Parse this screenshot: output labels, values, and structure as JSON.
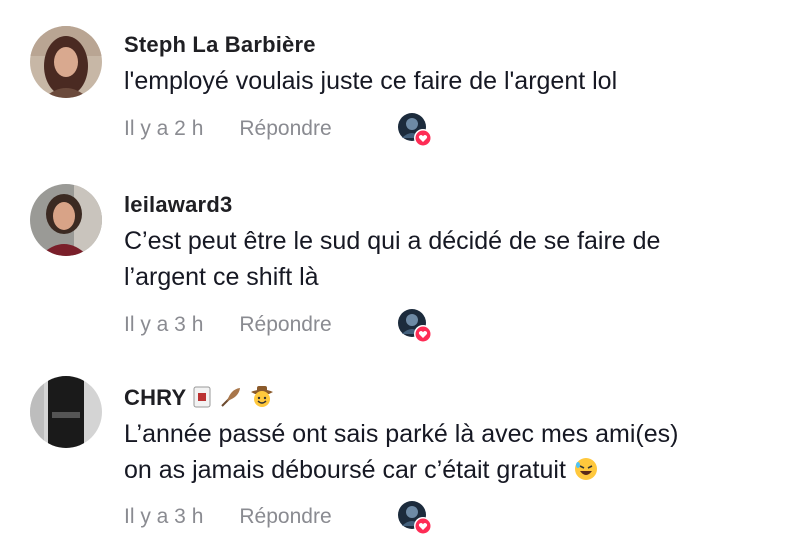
{
  "comments": [
    {
      "username": "Steph La Barbière",
      "text": "l'employé voulais juste ce faire de l'argent lol",
      "time": "Il y a 2 h",
      "reply": "Répondre"
    },
    {
      "username": "leilaward3",
      "text_line1": "C’est peut être le sud qui a décidé de se faire de",
      "text_line2": "l’argent ce shift là",
      "time": "Il y a 3 h",
      "reply": "Répondre"
    },
    {
      "username": "CHRY",
      "username_emojis": [
        "playing-card-icon",
        "feather-icon",
        "cowboy-face-icon"
      ],
      "text_line1": "L’année passé ont sais parké là avec mes ami(es)",
      "text_line2": "on as jamais déboursé car c’était gratuit",
      "text_emoji": "rolling-laughing-icon",
      "time": "Il y a 3 h",
      "reply": "Répondre"
    }
  ],
  "colors": {
    "text": "#161823",
    "meta": "#8a8b91",
    "heart": "#fe2c55"
  }
}
